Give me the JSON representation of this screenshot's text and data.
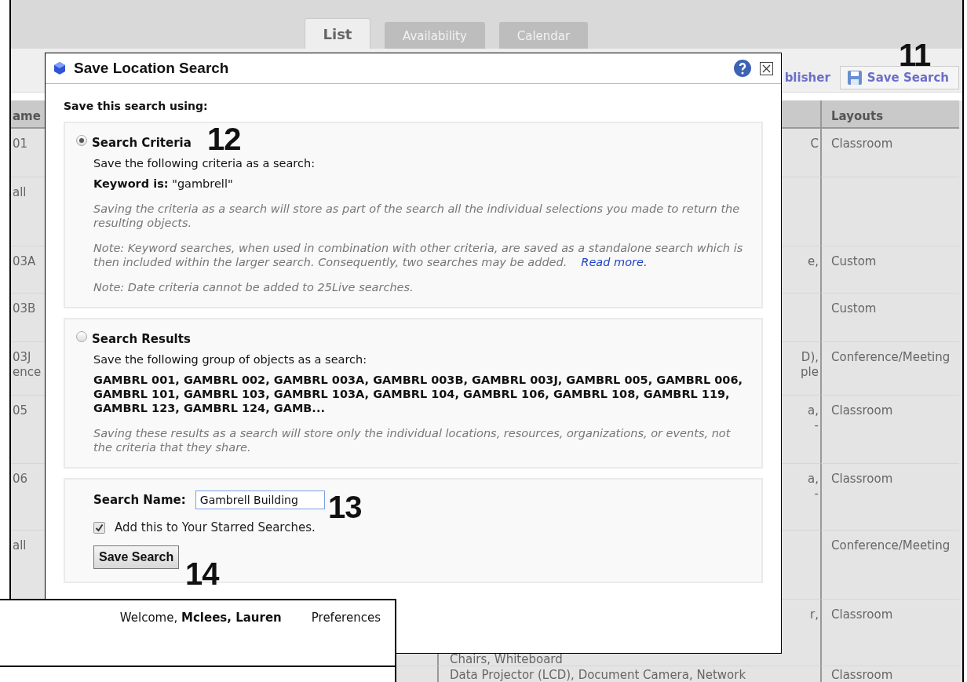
{
  "tabs": [
    {
      "label": "List",
      "selected": true
    },
    {
      "label": "Availability",
      "selected": false
    },
    {
      "label": "Calendar",
      "selected": false
    }
  ],
  "toolbar": {
    "buttons": [
      {
        "label": "blisher",
        "kind": "link"
      },
      {
        "label": "Save Search",
        "kind": "save"
      }
    ]
  },
  "table": {
    "columns": [
      "ame",
      "Layouts"
    ],
    "rows": [
      {
        "name": [
          "01"
        ],
        "tail": [
          "C"
        ],
        "layouts": "Classroom"
      },
      {
        "name": [
          "all"
        ],
        "tail": []
      },
      {
        "name": [
          "03A"
        ],
        "tail": [
          "e,"
        ],
        "layouts": "Custom"
      },
      {
        "name": [
          "03B"
        ],
        "tail": [],
        "layouts": "Custom"
      },
      {
        "name": [
          "03J",
          "ence"
        ],
        "tail": [
          "D),",
          "ple"
        ],
        "layouts": "Conference/Meeting"
      },
      {
        "name": [
          "05"
        ],
        "tail": [
          "a,",
          "-"
        ],
        "layouts": "Classroom"
      },
      {
        "name": [
          "06"
        ],
        "tail": [
          "a,",
          "-"
        ],
        "layouts": "Classroom"
      },
      {
        "name": [
          "all"
        ],
        "tail": [],
        "layouts": "Conference/Meeting"
      },
      {
        "name": [],
        "tail": [
          "r,"
        ],
        "lower": "Chairs, Whiteboard",
        "layouts": "Classroom"
      },
      {
        "name": [],
        "tail": [],
        "lower": "Data Projector (LCD), Document Camera, Network",
        "layouts": "Classroom"
      }
    ]
  },
  "dialog": {
    "title": "Save Location Search",
    "intro": "Save this search using:",
    "options": [
      {
        "label": "Search Criteria",
        "selected": true,
        "lead": "Save the following criteria as a search:",
        "detail": "**Keyword is:** \"gambrell\"",
        "detail_bold": false,
        "notes": [
          {
            "text": "Saving the criteria as a search will store as part of the search all the individual selections you made to return the resulting objects."
          },
          {
            "text": "Note: Keyword searches, when used in combination with other criteria, are saved as a standalone search which is then included within the larger search. Consequently, two searches may be added.",
            "link": "Read more."
          },
          {
            "text": "Note: Date criteria cannot be added to 25Live searches."
          }
        ]
      },
      {
        "label": "Search Results",
        "selected": false,
        "lead": "Save the following group of objects as a search:",
        "detail": "GAMBRL 001, GAMBRL 002, GAMBRL 003A, GAMBRL 003B, GAMBRL 003J, GAMBRL 005, GAMBRL 006, GAMBRL 101, GAMBRL 103, GAMBRL 103A, GAMBRL 104, GAMBRL 106, GAMBRL 108, GAMBRL 119, GAMBRL 123, GAMBRL 124, GAMB...",
        "detail_bold": true,
        "notes": [
          {
            "text": "Saving these results as a search will store only the individual locations, resources, organizations, or events, not the criteria that they share."
          }
        ]
      }
    ],
    "name_label": "Search Name:",
    "name_value": "Gambrell Building",
    "starred": {
      "label": "Add this to Your Starred Searches.",
      "checked": true
    },
    "save_button": "Save Search"
  },
  "user_panel": {
    "welcome": "Welcome, **Mclees, Lauren**",
    "preferences": "Preferences"
  },
  "annotations": [
    "11",
    "12",
    "13",
    "14"
  ]
}
